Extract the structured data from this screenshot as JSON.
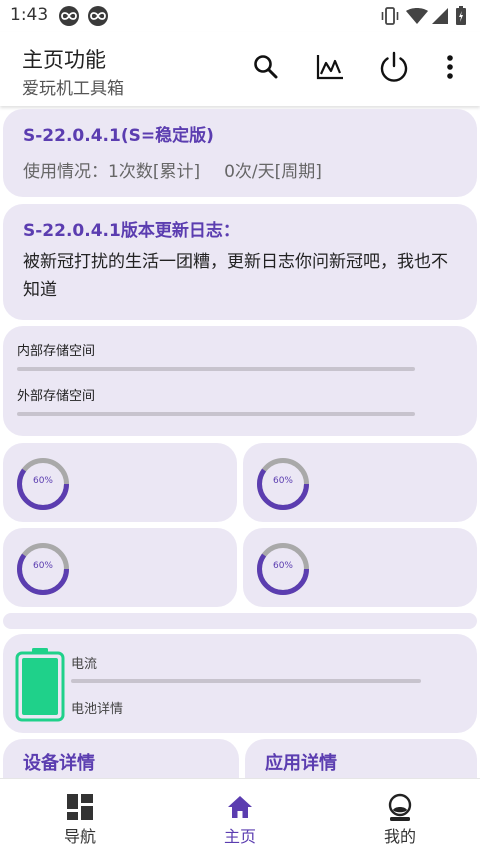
{
  "status_bar": {
    "time": "1:43"
  },
  "app_bar": {
    "title": "主页功能",
    "subtitle": "爱玩机工具箱"
  },
  "version_card": {
    "title": "S-22.0.4.1(S=稳定版)",
    "usage_total": "使用情况：1次数[累计]",
    "usage_period": "0次/天[周期]"
  },
  "changelog_card": {
    "title": "S-22.0.4.1版本更新日志：",
    "body": "被新冠打扰的生活一团糟，更新日志你问新冠吧，我也不知道"
  },
  "storage_card": {
    "internal_label": "内部存储空间",
    "external_label": "外部存储空间"
  },
  "gauges": [
    {
      "label": "60%",
      "value": 0.6
    },
    {
      "label": "60%",
      "value": 0.6
    },
    {
      "label": "60%",
      "value": 0.6
    },
    {
      "label": "60%",
      "value": 0.6
    }
  ],
  "battery_card": {
    "current_label": "电流",
    "detail_label": "电池详情"
  },
  "sections": {
    "device": "设备详情",
    "apps": "应用详情"
  },
  "bottom_nav": [
    {
      "label": "导航",
      "icon": "dashboard-icon",
      "active": false
    },
    {
      "label": "主页",
      "icon": "home-icon",
      "active": true
    },
    {
      "label": "我的",
      "icon": "account-icon",
      "active": false
    }
  ],
  "colors": {
    "accent": "#5b3db0",
    "card_bg": "#ebe7f4",
    "gauge_track": "#a9a9a9",
    "battery_green": "#1fd18a"
  }
}
